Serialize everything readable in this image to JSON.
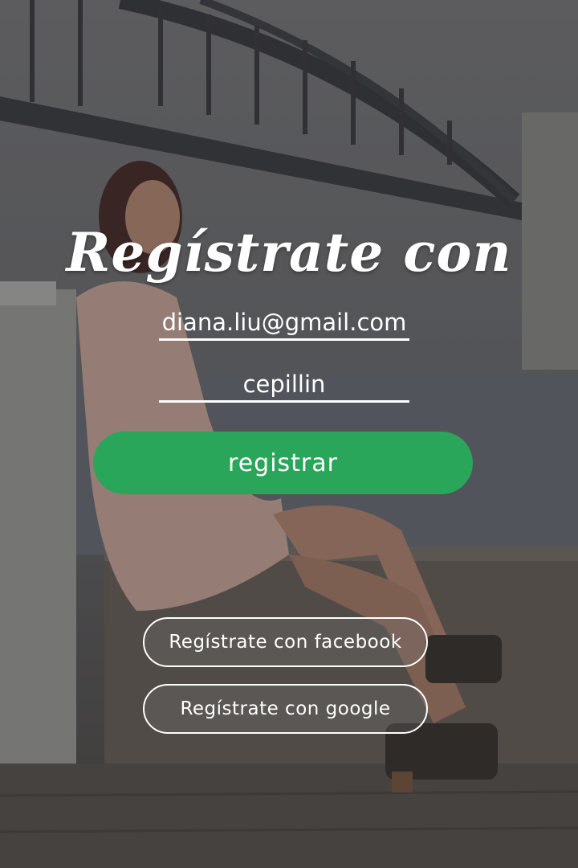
{
  "screen": {
    "title": "Regístrate con"
  },
  "form": {
    "email_value": "diana.liu@gmail.com",
    "password_value": "cepillin",
    "register_label": "registrar"
  },
  "social": {
    "facebook_label": "Regístrate con facebook",
    "google_label": "Regístrate con google"
  },
  "colors": {
    "primary_button": "#2aa65a",
    "text": "#ffffff",
    "overlay": "#5c5c5e"
  }
}
